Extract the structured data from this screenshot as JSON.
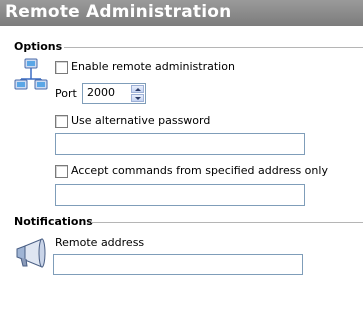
{
  "window": {
    "title": "Remote Administration"
  },
  "options": {
    "heading": "Options",
    "enable_remote": {
      "label": "Enable remote administration",
      "checked": false
    },
    "port": {
      "label": "Port",
      "value": "2000"
    },
    "alt_password": {
      "label": "Use alternative password",
      "checked": false,
      "value": ""
    },
    "accept_commands": {
      "label": "Accept commands from specified address only",
      "checked": false,
      "value": ""
    }
  },
  "notifications": {
    "heading": "Notifications",
    "remote_address": {
      "label": "Remote address",
      "value": ""
    }
  },
  "icons": {
    "options": "network-computers-icon",
    "notifications": "megaphone-icon"
  }
}
